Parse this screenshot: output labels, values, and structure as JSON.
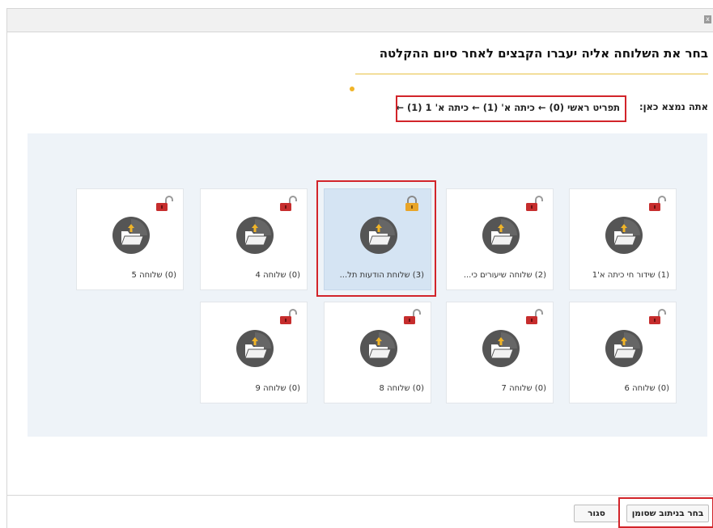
{
  "window": {
    "close_glyph": "x"
  },
  "dialog": {
    "title": "בחר את השלוחה אליה יעברו הקבצים לאחר סיום ההקלטה",
    "location_label": "אתה נמצא כאן:",
    "breadcrumb": "תפריט ראשי (0) ← כיתה א' (1) ← כיתה א' 1 (1) ←"
  },
  "colors": {
    "accent_rule": "#e7c043",
    "highlight_frame": "#d2242a",
    "lock_red": "#c62d2d",
    "lock_gold": "#e9a528",
    "folder_circle": "#555555",
    "selected_tile_bg": "#d5e4f3"
  },
  "tiles": [
    {
      "label": "(1) שידור חי כיתה א'1",
      "lock": "red-open-lock-icon",
      "selected": false
    },
    {
      "label": "(2) שלוחה שיעורים כי...",
      "lock": "red-open-lock-icon",
      "selected": false
    },
    {
      "label": "(3) שלוחת הודעות תל...",
      "lock": "gold-lock-icon",
      "selected": true
    },
    {
      "label": "(0) שלוחה 4",
      "lock": "red-open-lock-icon",
      "selected": false
    },
    {
      "label": "(0) שלוחה 5",
      "lock": "red-open-lock-icon",
      "selected": false
    },
    {
      "label": "(0) שלוחה 6",
      "lock": "red-open-lock-icon",
      "selected": false
    },
    {
      "label": "(0) שלוחה 7",
      "lock": "red-open-lock-icon",
      "selected": false
    },
    {
      "label": "(0) שלוחה 8",
      "lock": "red-open-lock-icon",
      "selected": false
    },
    {
      "label": "(0) שלוחה 9",
      "lock": "red-open-lock-icon",
      "selected": false
    }
  ],
  "footer": {
    "select_button": "בחר בניתוב שסומן",
    "close_button": "סגור"
  }
}
